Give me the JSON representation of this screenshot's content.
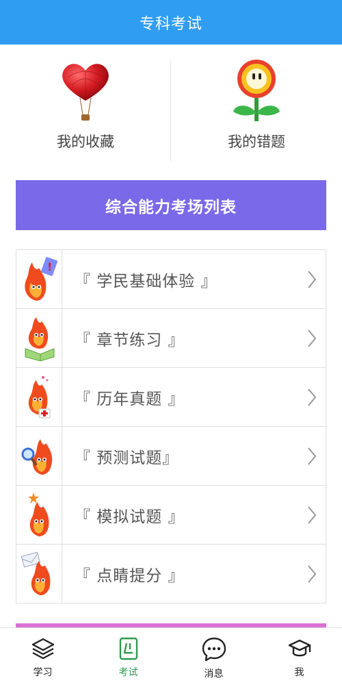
{
  "header": {
    "title": "专科考试"
  },
  "panels": [
    {
      "label": "我的收藏",
      "icon": "heart-balloon-icon"
    },
    {
      "label": "我的错题",
      "icon": "flower-icon"
    }
  ],
  "section": {
    "title": "综合能力考场列表"
  },
  "list": [
    {
      "label": "『 学民基础体验 』",
      "icon": "flame-exclamation-icon"
    },
    {
      "label": "『 章节练习 』",
      "icon": "flame-book-icon"
    },
    {
      "label": "『 历年真题 』",
      "icon": "flame-firstaid-icon"
    },
    {
      "label": "『 预测试题』",
      "icon": "flame-magnifier-icon"
    },
    {
      "label": "『 模拟试题 』",
      "icon": "flame-star-icon"
    },
    {
      "label": "『 点睛提分 』",
      "icon": "flame-envelope-icon"
    }
  ],
  "tabs": [
    {
      "label": "学习",
      "icon": "layers-icon"
    },
    {
      "label": "考试",
      "icon": "exam-icon",
      "active": true
    },
    {
      "label": "消息",
      "icon": "chat-icon"
    },
    {
      "label": "我",
      "icon": "graduation-cap-icon"
    }
  ],
  "colors": {
    "header": "#2f9df2",
    "banner": "#7a69e9",
    "strip": "#d873d4",
    "active_tab": "#2e9a4f"
  }
}
